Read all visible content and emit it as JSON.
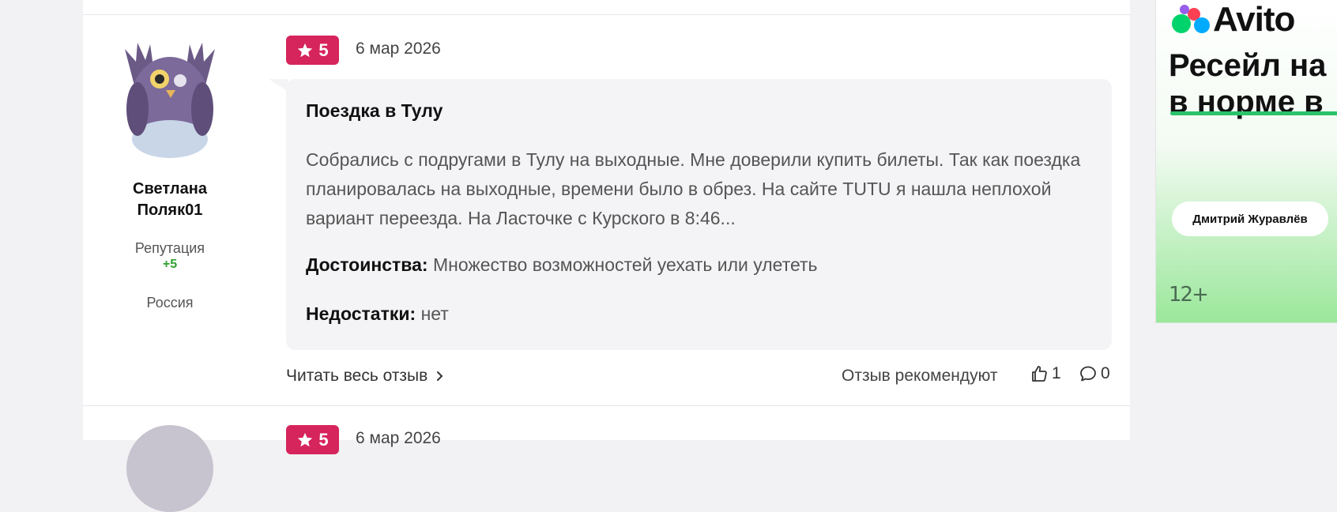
{
  "review": {
    "rating": "5",
    "date": "6 мар 2026",
    "title": "Поездка в Тулу",
    "text": "Собрались с подругами в Тулу на выходные. Мне доверили купить билеты. Так как поездка планировалась на выходные, времени было в обрез. На сайте TUTU я нашла неплохой вариант переезда. На Ласточке с Курского в 8:46...",
    "pros_label": "Достоинства:",
    "pros_value": "Множество возможностей уехать или улететь",
    "cons_label": "Недостатки:",
    "cons_value": "нет",
    "read_more": "Читать весь отзыв",
    "recommend_label": "Отзыв рекомендуют",
    "likes": "1",
    "comments": "0"
  },
  "author": {
    "name": "Светлана Поляк01",
    "reputation_label": "Репутация",
    "reputation_value": "+5",
    "country": "Россия"
  },
  "next_review": {
    "rating": "5",
    "date": "6 мар 2026"
  },
  "ad": {
    "brand": "Avito",
    "headline_line1": "Ресейл на",
    "headline_line2": "в норме в",
    "button": "Дмитрий Журавлёв",
    "age": "12+"
  },
  "colors": {
    "rating_badge": "#d6245c",
    "reputation": "#2fa12f",
    "bubble": "#f4f4f6"
  }
}
